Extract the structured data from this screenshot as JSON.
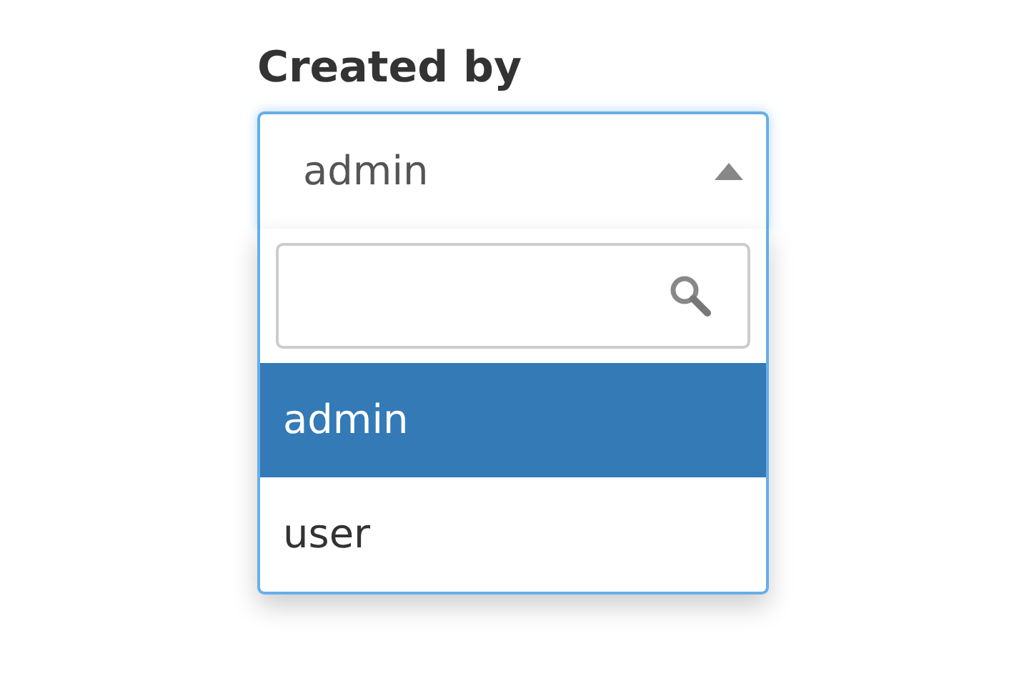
{
  "field_label": "Created by",
  "select": {
    "value": "admin",
    "expanded": true
  },
  "options": [
    {
      "label": "admin",
      "selected": true
    },
    {
      "label": "user",
      "selected": false
    }
  ]
}
